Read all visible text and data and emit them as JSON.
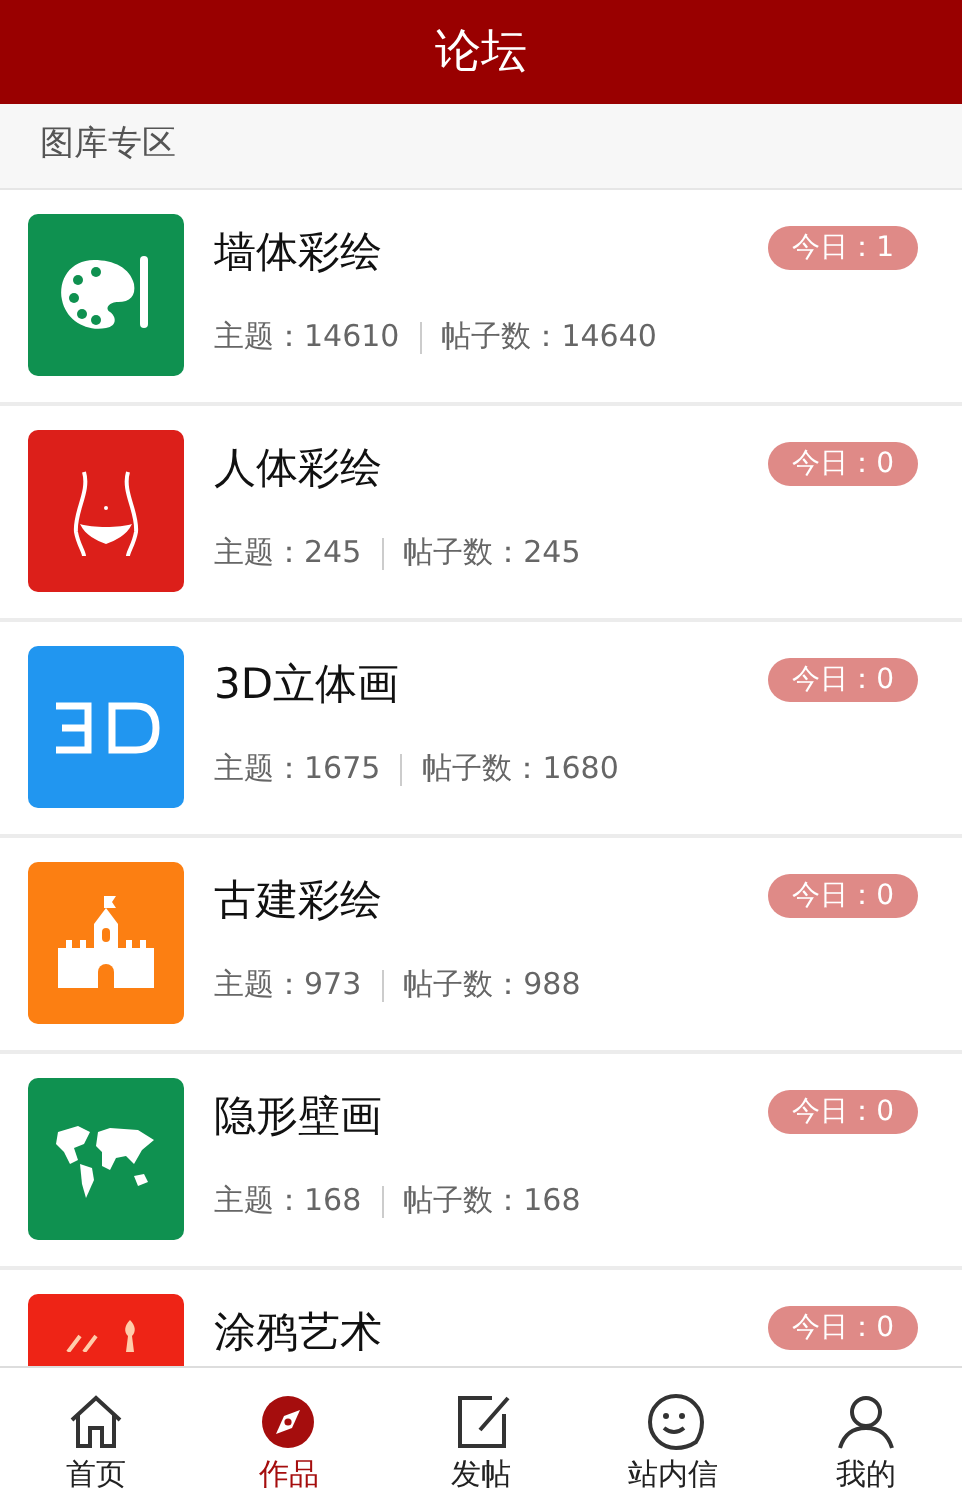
{
  "header": {
    "title": "论坛"
  },
  "section": {
    "title": "图库专区"
  },
  "forums": [
    {
      "name": "墙体彩绘",
      "today": "今日：1",
      "topics_label": "主题：",
      "topics": "14610",
      "posts_label": "帖子数：",
      "posts": "14640",
      "color": "#0f9150"
    },
    {
      "name": "人体彩绘",
      "today": "今日：0",
      "topics_label": "主题：",
      "topics": "245",
      "posts_label": "帖子数：",
      "posts": "245",
      "color": "#dc1f1a"
    },
    {
      "name": "3D立体画",
      "today": "今日：0",
      "topics_label": "主题：",
      "topics": "1675",
      "posts_label": "帖子数：",
      "posts": "1680",
      "color": "#2196f0"
    },
    {
      "name": "古建彩绘",
      "today": "今日：0",
      "topics_label": "主题：",
      "topics": "973",
      "posts_label": "帖子数：",
      "posts": "988",
      "color": "#fc7f12"
    },
    {
      "name": "隐形壁画",
      "today": "今日：0",
      "topics_label": "主题：",
      "topics": "168",
      "posts_label": "帖子数：",
      "posts": "168",
      "color": "#0f9150"
    },
    {
      "name": "涂鸦艺术",
      "today": "今日：0",
      "color": "#ee2416"
    }
  ],
  "tabs": [
    {
      "label": "首页",
      "selected": false
    },
    {
      "label": "作品",
      "selected": true
    },
    {
      "label": "发帖",
      "selected": false
    },
    {
      "label": "站内信",
      "selected": false
    },
    {
      "label": "我的",
      "selected": false
    }
  ]
}
